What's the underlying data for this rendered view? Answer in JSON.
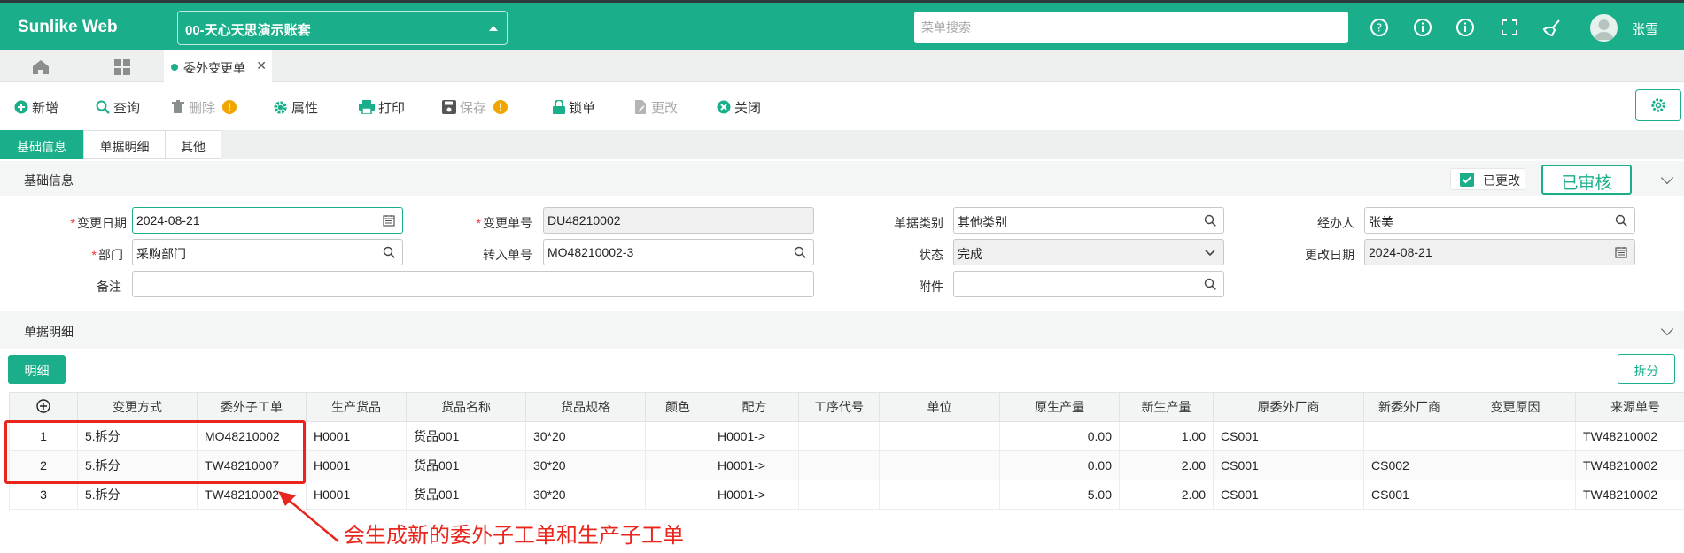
{
  "app": {
    "brand": "Sunlike Web",
    "account": "00-天心天思演示账套",
    "search_placeholder": "菜单搜索",
    "user": "张雪"
  },
  "tabs": {
    "page_tab": "委外变更单"
  },
  "toolbar": {
    "add": "新增",
    "query": "查询",
    "delete": "删除",
    "attr": "属性",
    "print": "打印",
    "save": "保存",
    "lock": "锁单",
    "modify": "更改",
    "close": "关闭"
  },
  "subtabs": [
    "基础信息",
    "单据明细",
    "其他"
  ],
  "basic": {
    "section_title": "基础信息",
    "changed_label": "已更改",
    "audited_label": "已审核",
    "change_date_label": "变更日期",
    "change_date": "2024-08-21",
    "change_no_label": "变更单号",
    "change_no": "DU48210002",
    "doc_type_label": "单据类别",
    "doc_type": "其他类别",
    "handler_label": "经办人",
    "handler": "张美",
    "dept_label": "部门",
    "dept": "采购部门",
    "import_no_label": "转入单号",
    "import_no": "MO48210002-3",
    "status_label": "状态",
    "status": "完成",
    "modify_date_label": "更改日期",
    "modify_date": "2024-08-21",
    "remark_label": "备注",
    "remark": "",
    "attach_label": "附件",
    "attach": ""
  },
  "detail": {
    "section_title": "单据明细",
    "detail_btn": "明细",
    "split_btn": "拆分",
    "columns": [
      "变更方式",
      "委外子工单",
      "生产货品",
      "货品名称",
      "货品规格",
      "颜色",
      "配方",
      "工序代号",
      "单位",
      "原生产量",
      "新生产量",
      "原委外厂商",
      "新委外厂商",
      "变更原因",
      "来源单号"
    ],
    "rows": [
      {
        "no": "1",
        "mode": "5.拆分",
        "sub_order": "MO48210002",
        "product": "H0001",
        "name": "货品001",
        "spec": "30*20",
        "color": "",
        "formula": "H0001->",
        "process": "",
        "unit": "",
        "old_qty": "0.00",
        "new_qty": "1.00",
        "old_vendor": "CS001",
        "new_vendor": "",
        "reason": "",
        "source": "TW48210002"
      },
      {
        "no": "2",
        "mode": "5.拆分",
        "sub_order": "TW48210007",
        "product": "H0001",
        "name": "货品001",
        "spec": "30*20",
        "color": "",
        "formula": "H0001->",
        "process": "",
        "unit": "",
        "old_qty": "0.00",
        "new_qty": "2.00",
        "old_vendor": "CS001",
        "new_vendor": "CS002",
        "reason": "",
        "source": "TW48210002"
      },
      {
        "no": "3",
        "mode": "5.拆分",
        "sub_order": "TW48210002",
        "product": "H0001",
        "name": "货品001",
        "spec": "30*20",
        "color": "",
        "formula": "H0001->",
        "process": "",
        "unit": "",
        "old_qty": "5.00",
        "new_qty": "2.00",
        "old_vendor": "CS001",
        "new_vendor": "CS001",
        "reason": "",
        "source": "TW48210002"
      }
    ]
  },
  "annotation": {
    "text": "会生成新的委外子工单和生产子工单"
  },
  "colors": {
    "brand": "#1aae8a",
    "annotation": "#e8261d"
  }
}
